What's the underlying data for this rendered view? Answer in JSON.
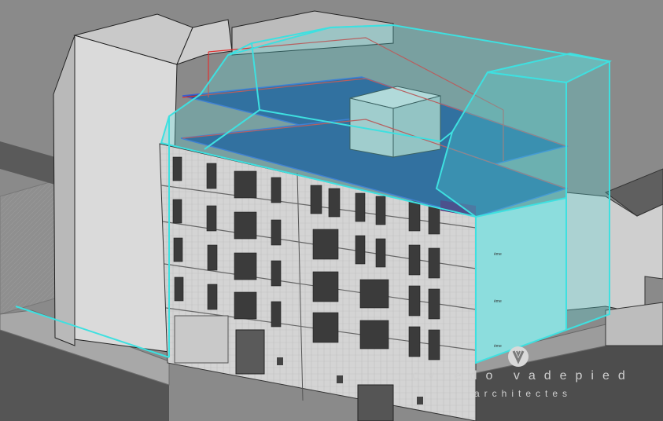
{
  "scene": {
    "ground_color": "#8c8c8c",
    "road_color": "#5e5e5e",
    "sidewalk_color": "#a9a9a9",
    "building_color": "#d8d8d8",
    "roof_color": "#c6c6c6",
    "envelope_color": "#43d6d6",
    "floor_slab_color": "#2a4c8a",
    "section_line_color": "#e03030",
    "facade_color": "#d9d9d9",
    "window_color": "#3a3a3a"
  },
  "watermark": {
    "logo_icon": "ov-logo-icon",
    "name": "oviedo vadepied",
    "subtitle": "architectes"
  }
}
